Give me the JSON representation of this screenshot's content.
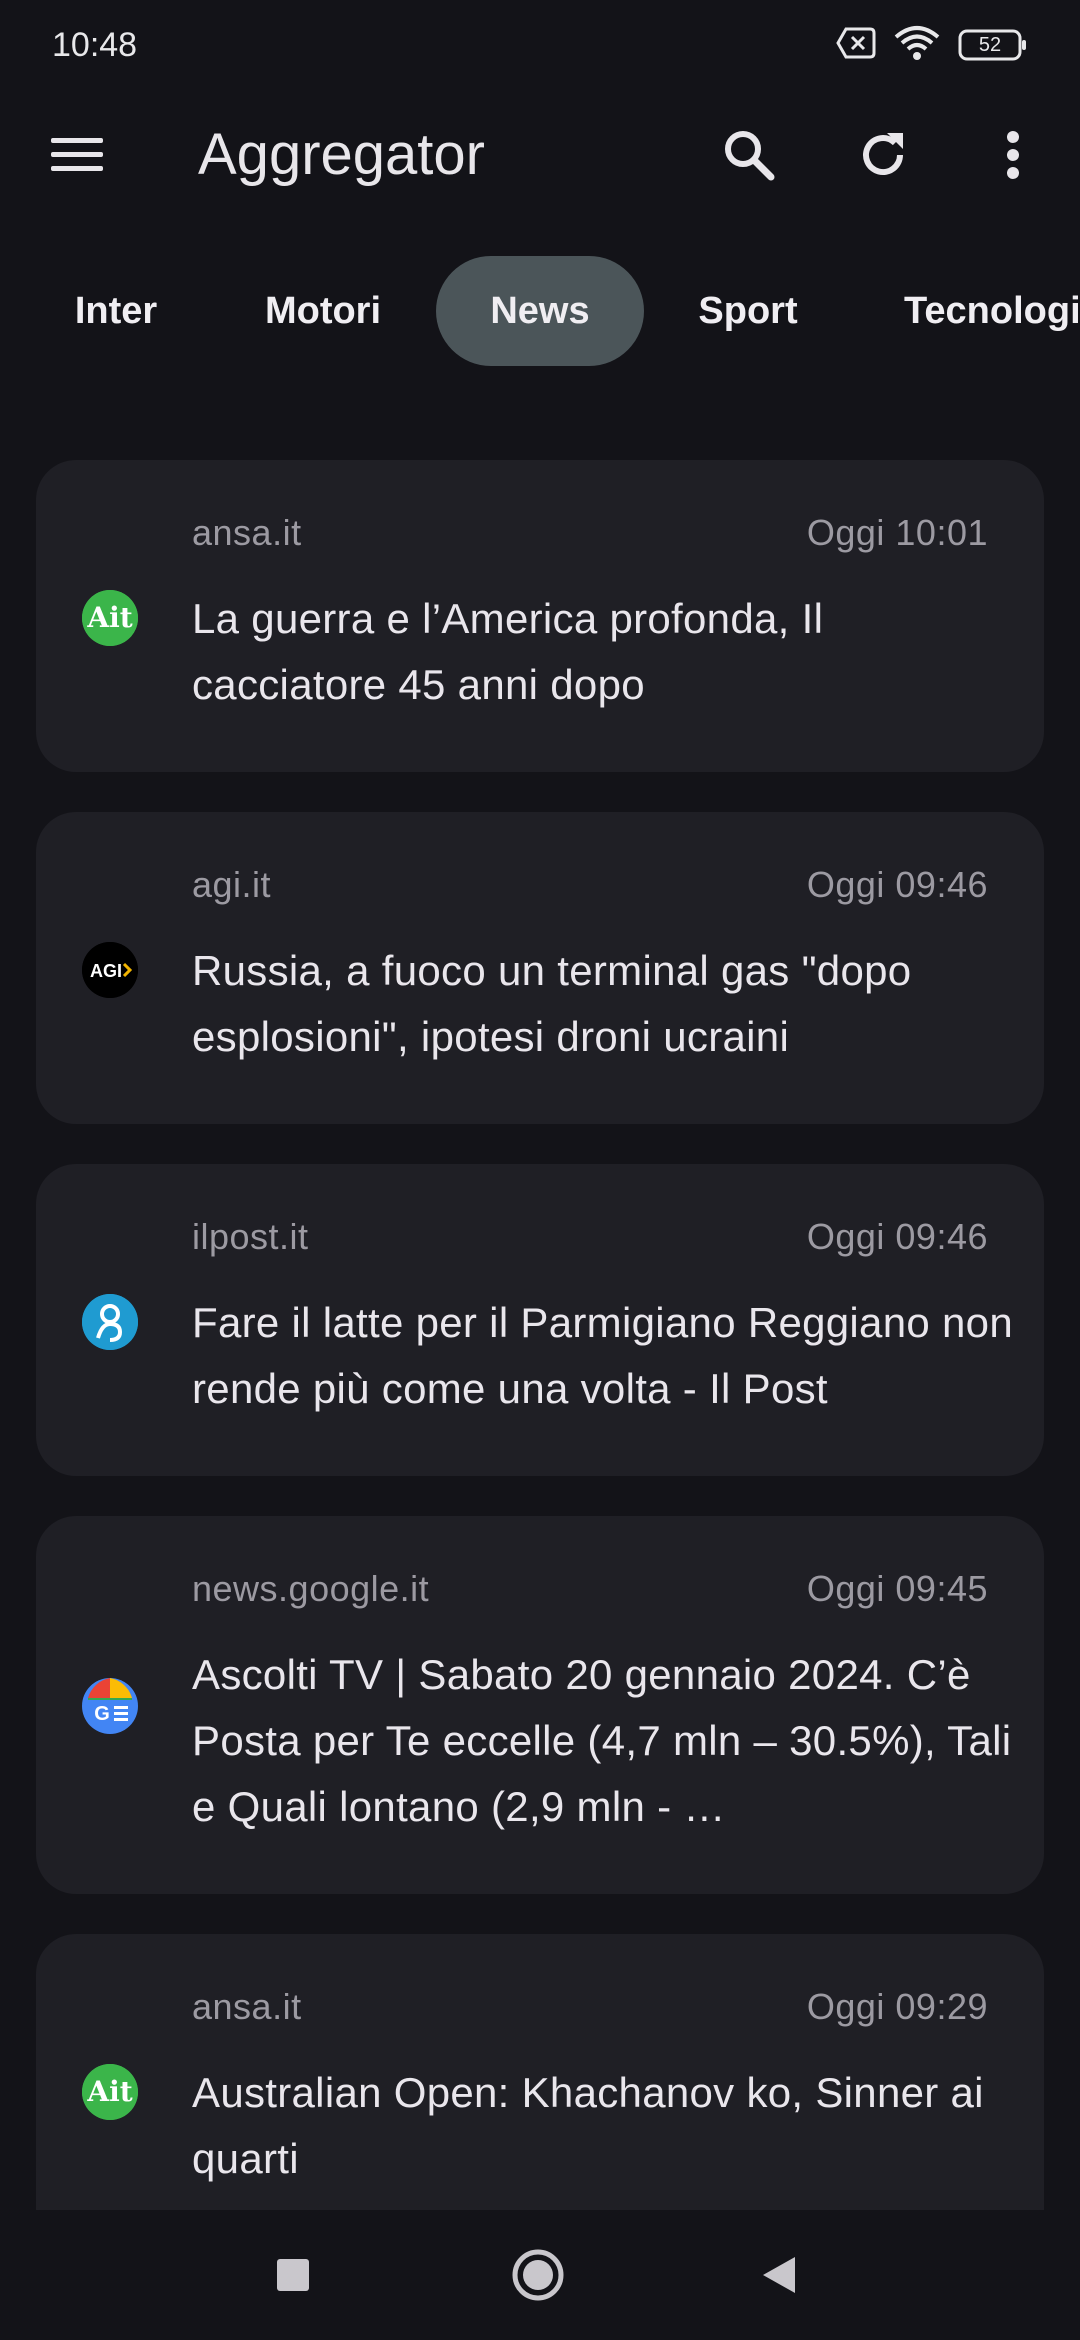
{
  "status_bar": {
    "time": "10:48",
    "battery": "52",
    "icons": [
      "sim-off-icon",
      "wifi-icon",
      "battery-icon"
    ]
  },
  "app_bar": {
    "title": "Aggregator",
    "icons": [
      "menu-icon",
      "search-icon",
      "refresh-icon",
      "more-vert-icon"
    ]
  },
  "tabs": [
    {
      "label": "Inter"
    },
    {
      "label": "Motori"
    },
    {
      "label": "News"
    },
    {
      "label": "Sport"
    },
    {
      "label": "Tecnologia"
    }
  ],
  "active_tab": "News",
  "articles": [
    {
      "source": "ansa.it",
      "time": "Oggi 10:01",
      "title": "La guerra e l’America profonda, Il cacciatore 45 anni dopo",
      "logo": "ansa-logo-icon",
      "logo_text": "Ait"
    },
    {
      "source": "agi.it",
      "time": "Oggi 09:46",
      "title": "Russia, a fuoco un terminal gas \"dopo esplosioni\", ipotesi droni ucraini",
      "logo": "agi-logo-icon",
      "logo_text": "AGI"
    },
    {
      "source": "ilpost.it",
      "time": "Oggi 09:46",
      "title": "Fare il latte per il Parmigiano Reggiano non rende più come una volta - Il Post",
      "logo": "ilpost-logo-icon",
      "logo_text": ""
    },
    {
      "source": "news.google.it",
      "time": "Oggi 09:45",
      "title": "Ascolti TV | Sabato 20 gennaio 2024. C’è Posta per Te eccelle (4,7 mln – 30.5%), Tali e Quali lontano (2,9 mln - …",
      "logo": "google-news-logo-icon",
      "logo_text": "G"
    },
    {
      "source": "ansa.it",
      "time": "Oggi 09:29",
      "title": "Australian Open: Khachanov ko, Sinner ai quarti",
      "logo": "ansa-logo-icon",
      "logo_text": "Ait"
    }
  ],
  "colors": {
    "background": "#131318",
    "card": "#1f1f25",
    "active_tab": "#4b5559",
    "secondary_text": "#9c9aa2",
    "ansa_green": "#3bb54a",
    "ilpost_blue": "#1f9bd1"
  },
  "nav_bar": {
    "icons": [
      "recents-square-icon",
      "home-circle-icon",
      "back-triangle-icon"
    ]
  }
}
